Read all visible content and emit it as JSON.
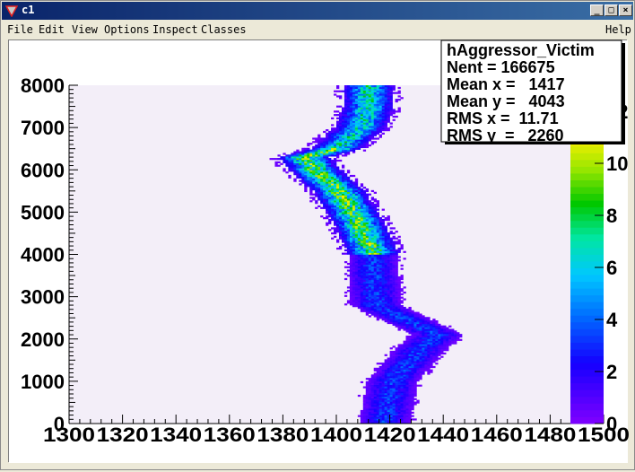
{
  "window": {
    "title": "c1"
  },
  "menu": {
    "items": [
      "File",
      "Edit",
      "View",
      "Options",
      "Inspect",
      "Classes"
    ],
    "help": "Help"
  },
  "stats": {
    "lines": [
      "hAggressor_Victim",
      "Nent = 166675",
      "Mean x =   1417",
      "Mean y =   4043",
      "RMS x =  11.71",
      "RMS y  =   2260"
    ]
  },
  "chart_data": {
    "type": "heatmap",
    "title": "",
    "xlabel": "",
    "ylabel": "",
    "xlim": [
      1300,
      1500
    ],
    "ylim": [
      0,
      8000
    ],
    "x_ticks": [
      "1300",
      "1320",
      "1340",
      "1360",
      "1380",
      "1400",
      "1420",
      "1440",
      "1460",
      "1480",
      "1500"
    ],
    "y_ticks": [
      "0",
      "1000",
      "2000",
      "3000",
      "4000",
      "5000",
      "6000",
      "7000",
      "8000"
    ],
    "z_range": [
      0,
      13
    ],
    "z_ticks": [
      "0",
      "2",
      "4",
      "6",
      "8",
      "10",
      "12"
    ],
    "band_center_x": [
      [
        0,
        1418
      ],
      [
        1000,
        1421
      ],
      [
        1800,
        1432
      ],
      [
        2100,
        1438
      ],
      [
        2400,
        1428
      ],
      [
        2800,
        1415
      ],
      [
        3500,
        1414
      ],
      [
        4000,
        1414
      ],
      [
        4800,
        1408
      ],
      [
        5500,
        1401
      ],
      [
        6000,
        1392
      ],
      [
        6300,
        1388
      ],
      [
        6500,
        1400
      ],
      [
        7000,
        1409
      ],
      [
        7500,
        1412
      ],
      [
        8000,
        1412
      ]
    ],
    "band_halfwidth_x": 9,
    "peak_regions": [
      {
        "y": [
          4000,
          6500
        ],
        "level": 9
      },
      {
        "y": [
          6500,
          8000
        ],
        "level": 7
      }
    ]
  }
}
